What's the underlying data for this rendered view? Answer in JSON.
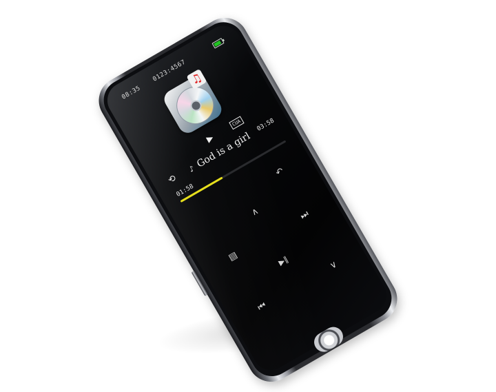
{
  "status": {
    "time": "08:35",
    "counter": "0123:4567",
    "battery_color": "#22c422"
  },
  "player": {
    "format": "CUA",
    "title": "God is a girl",
    "elapsed": "01:58",
    "total": "03:58",
    "progress": 0.4,
    "accent_color": "#e6df1c"
  },
  "icons": {
    "album": "music-cd-icon",
    "play_indicator": "play-icon",
    "repeat": "repeat-icon",
    "note": "music-note-icon"
  },
  "keys": {
    "back": "↶",
    "up": "∧",
    "next": "⏭",
    "menu": "▤",
    "play_pause": "▶‖",
    "prev": "⏮",
    "down": "∨"
  }
}
